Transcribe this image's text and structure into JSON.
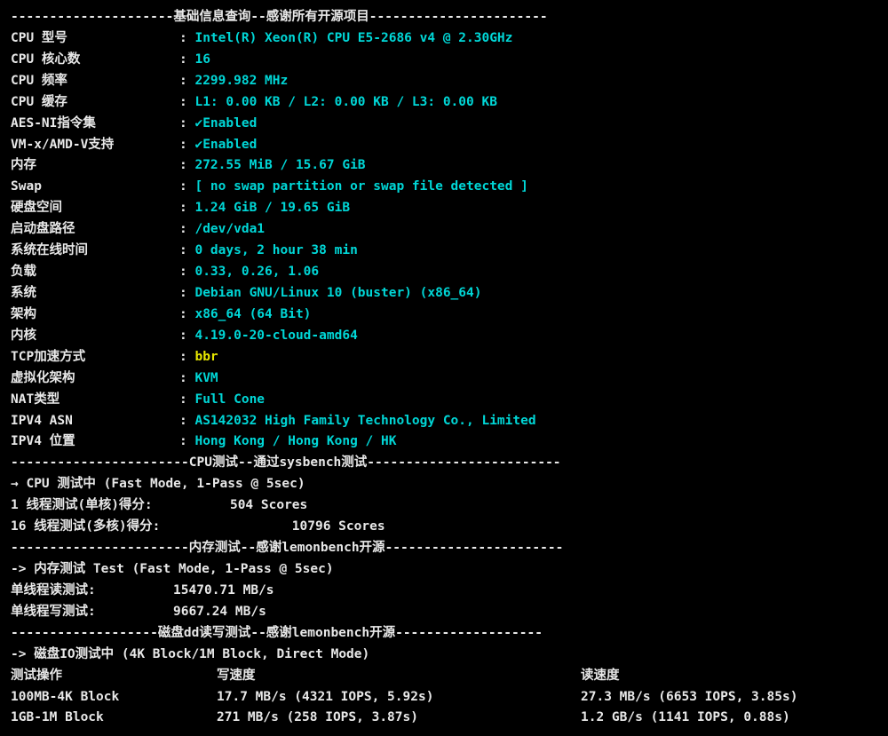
{
  "section1": {
    "title_prefix": "---------------------",
    "title": "基础信息查询--感谢所有开源项目",
    "title_suffix": "-----------------------",
    "rows": [
      {
        "label": "CPU 型号",
        "value": "Intel(R) Xeon(R) CPU E5-2686 v4 @ 2.30GHz",
        "style": "cyan"
      },
      {
        "label": "CPU 核心数",
        "value": "16",
        "style": "cyan"
      },
      {
        "label": "CPU 频率",
        "value": "2299.982 MHz",
        "style": "cyan"
      },
      {
        "label": "CPU 缓存",
        "value": "L1: 0.00 KB / L2: 0.00 KB / L3: 0.00 KB",
        "style": "cyan"
      },
      {
        "label": "AES-NI指令集",
        "value": "Enabled",
        "style": "check"
      },
      {
        "label": "VM-x/AMD-V支持",
        "value": "Enabled",
        "style": "check"
      },
      {
        "label": "内存",
        "value": "272.55 MiB / 15.67 GiB",
        "style": "cyan"
      },
      {
        "label": "Swap",
        "value": "[ no swap partition or swap file detected ]",
        "style": "cyan"
      },
      {
        "label": "硬盘空间",
        "value": "1.24 GiB / 19.65 GiB",
        "style": "cyan"
      },
      {
        "label": "启动盘路径",
        "value": "/dev/vda1",
        "style": "cyan"
      },
      {
        "label": "系统在线时间",
        "value": "0 days, 2 hour 38 min",
        "style": "cyan"
      },
      {
        "label": "负载",
        "value": "0.33, 0.26, 1.06",
        "style": "cyan"
      },
      {
        "label": "系统",
        "value": "Debian GNU/Linux 10 (buster) (x86_64)",
        "style": "cyan"
      },
      {
        "label": "架构",
        "value": "x86_64 (64 Bit)",
        "style": "cyan"
      },
      {
        "label": "内核",
        "value": "4.19.0-20-cloud-amd64",
        "style": "cyan"
      },
      {
        "label": "TCP加速方式",
        "value": "bbr",
        "style": "yellow"
      },
      {
        "label": "虚拟化架构",
        "value": "KVM",
        "style": "cyan"
      },
      {
        "label": "NAT类型",
        "value": "Full Cone",
        "style": "cyan"
      },
      {
        "label": "IPV4 ASN",
        "value": "AS142032 High Family Technology Co., Limited",
        "style": "cyan"
      },
      {
        "label": "IPV4 位置",
        "value": "Hong Kong / Hong Kong / HK",
        "style": "cyan"
      }
    ]
  },
  "section2": {
    "title_prefix": "-----------------------",
    "title": "CPU测试--通过sysbench测试",
    "title_suffix": "-------------------------",
    "subheader_arrow": "→",
    "subheader": " CPU 测试中 (Fast Mode, 1-Pass @ 5sec)",
    "line1_label": "1 线程测试(单核)得分:",
    "line1_pad": "          ",
    "line1_val": "504 Scores",
    "line2_label": "16 线程测试(多核)得分:",
    "line2_pad": "                 ",
    "line2_val": "10796 Scores"
  },
  "section3": {
    "title_prefix": "-----------------------",
    "title": "内存测试--感谢lemonbench开源",
    "title_suffix": "-----------------------",
    "subheader_arrow": "->",
    "subheader": " 内存测试 Test (Fast Mode, 1-Pass @ 5sec)",
    "line1_label": "单线程读测试:",
    "line1_pad": "          ",
    "line1_val": "15470.71 MB/s",
    "line2_label": "单线程写测试:",
    "line2_pad": "          ",
    "line2_val": "9667.24 MB/s"
  },
  "section4": {
    "title_prefix": "-------------------",
    "title": "磁盘dd读写测试--感谢lemonbench开源",
    "title_suffix": "-------------------",
    "subheader_arrow": "->",
    "subheader": " 磁盘IO测试中 (4K Block/1M Block, Direct Mode)",
    "header_c1": "测试操作",
    "header_c2": "写速度",
    "header_c3": "读速度",
    "rows": [
      {
        "c1": "100MB-4K Block",
        "c2": "17.7 MB/s (4321 IOPS, 5.92s)",
        "c3": "27.3 MB/s (6653 IOPS, 3.85s)"
      },
      {
        "c1": "1GB-1M Block",
        "c2": "271 MB/s (258 IOPS, 3.87s)",
        "c3": "1.2 GB/s (1141 IOPS, 0.88s)"
      }
    ]
  }
}
